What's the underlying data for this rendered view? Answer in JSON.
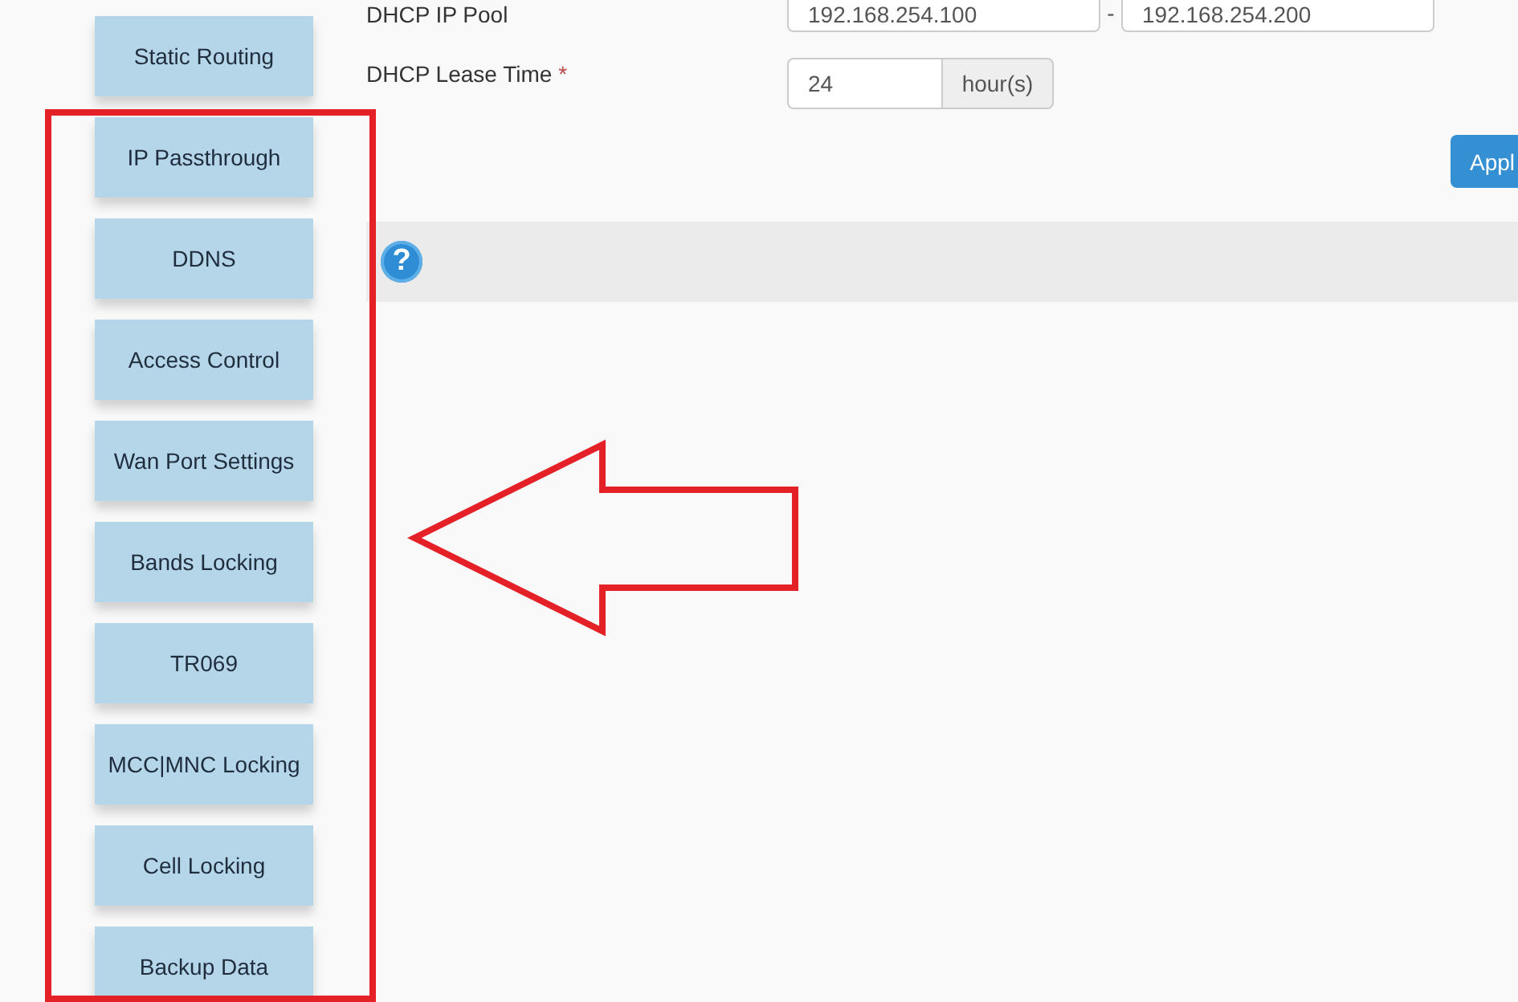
{
  "sidebar": {
    "items": [
      {
        "label": "Static Routing"
      },
      {
        "label": "IP Passthrough"
      },
      {
        "label": "DDNS"
      },
      {
        "label": "Access Control"
      },
      {
        "label": "Wan Port Settings"
      },
      {
        "label": "Bands Locking"
      },
      {
        "label": "TR069"
      },
      {
        "label": "MCC|MNC Locking"
      },
      {
        "label": "Cell Locking"
      },
      {
        "label": "Backup Data"
      }
    ]
  },
  "form": {
    "ip_pool": {
      "label": "DHCP IP Pool",
      "start": "192.168.254.100",
      "separator": "-",
      "end": "192.168.254.200"
    },
    "lease_time": {
      "label": "DHCP Lease Time",
      "required_mark": "*",
      "value": "24",
      "unit": "hour(s)"
    },
    "apply_button": "Appl"
  },
  "help_bar": {
    "icon": "?"
  }
}
